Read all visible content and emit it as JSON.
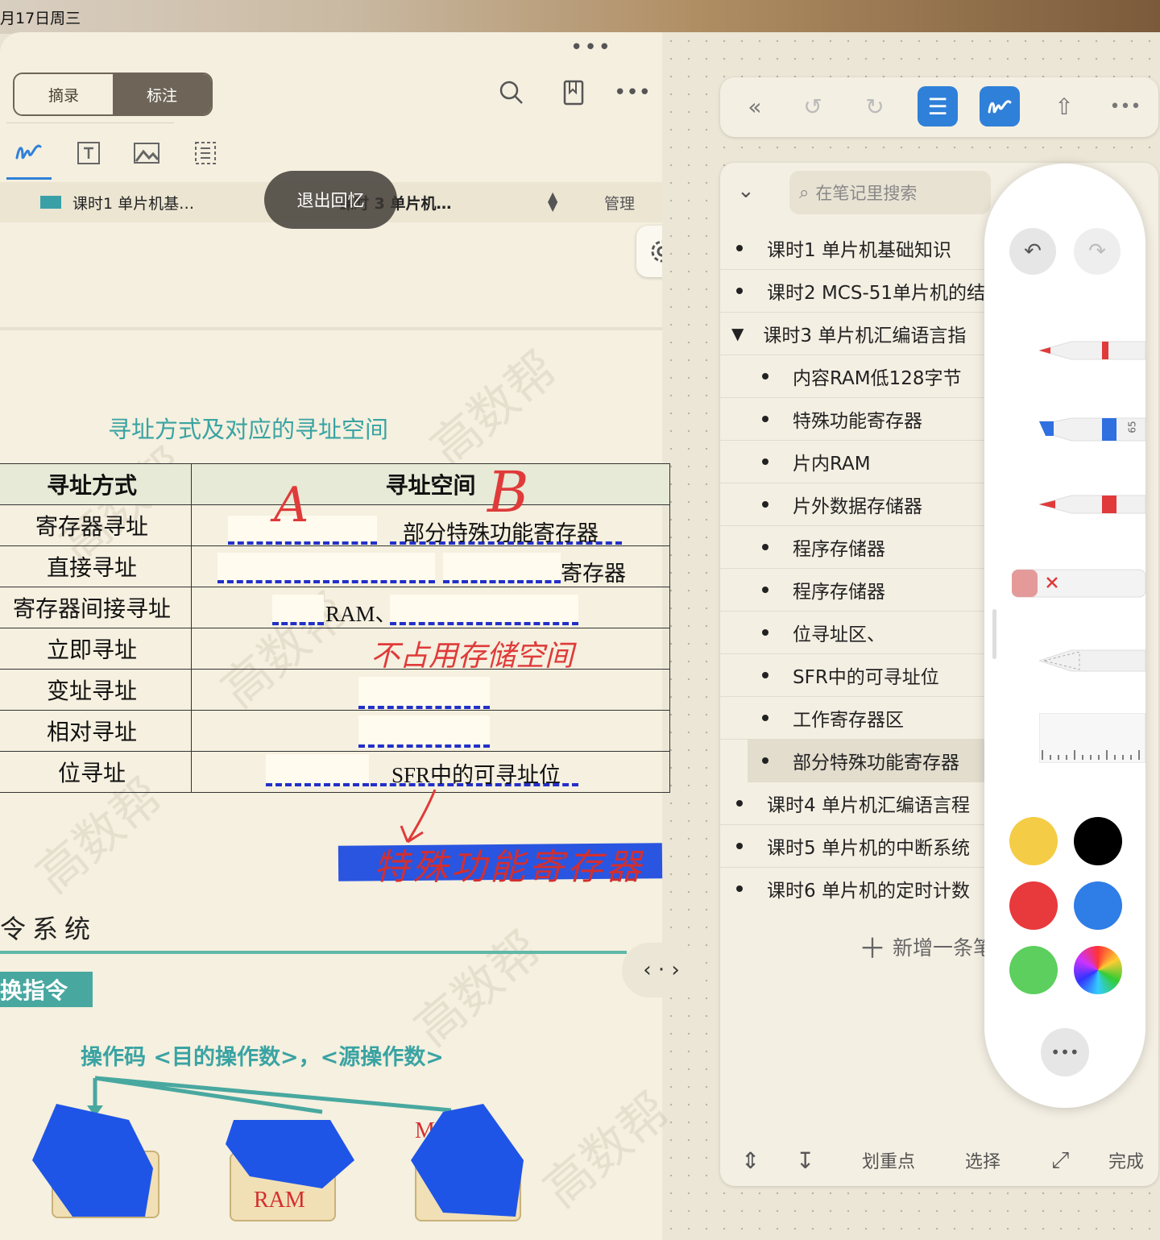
{
  "status_bar": {
    "date": "月17日周三"
  },
  "left_pane": {
    "segment": {
      "excerpt": "摘录",
      "annotate": "标注"
    },
    "doc_tabs": {
      "tab1": "课时1 单片机基…",
      "tab2": "课时 3 单片机…",
      "manage": "管理"
    },
    "recall_exit": "退出回忆",
    "section_title": "寻址方式及对应的寻址空间",
    "table": {
      "headers": [
        "寻址方式",
        "寻址空间"
      ],
      "rows": [
        {
          "mode": "寄存器寻址",
          "space": "部分特殊功能寄存器"
        },
        {
          "mode": "直接寻址",
          "space": "寄存器"
        },
        {
          "mode": "寄存器间接寻址",
          "space": "RAM、"
        },
        {
          "mode": "立即寻址",
          "space": ""
        },
        {
          "mode": "变址寻址",
          "space": ""
        },
        {
          "mode": "相对寻址",
          "space": ""
        },
        {
          "mode": "位寻址",
          "space": "SFR中的可寻址位"
        }
      ]
    },
    "handwriting": {
      "a": "A",
      "b": "B",
      "immediate_note": "不占用存储空间",
      "sfr_note": "特殊功能寄存器"
    },
    "heading_partial": "令系统",
    "subheading_partial": "换指令",
    "operand_line": "操作码 <目的操作数>，<源操作数>",
    "box_labels": {
      "ram": "RAM",
      "mov": "MOV"
    },
    "watermark": "高数帮"
  },
  "right_pane": {
    "search_placeholder": "在笔记里搜索",
    "outline": [
      {
        "label": "课时1 单片机基础知识",
        "level": 0
      },
      {
        "label": "课时2 MCS-51单片机的结",
        "level": 0
      },
      {
        "label": "课时3 单片机汇编语言指",
        "level": 0,
        "expanded": true
      },
      {
        "label": "内容RAM低128字节",
        "level": 1
      },
      {
        "label": "特殊功能寄存器",
        "level": 1
      },
      {
        "label": "片内RAM",
        "level": 1
      },
      {
        "label": "片外数据存储器",
        "level": 1
      },
      {
        "label": "程序存储器",
        "level": 1
      },
      {
        "label": "程序存储器",
        "level": 1
      },
      {
        "label": "位寻址区、",
        "level": 1
      },
      {
        "label": "SFR中的可寻址位",
        "level": 1
      },
      {
        "label": "工作寄存器区",
        "level": 1
      },
      {
        "label": "部分特殊功能寄存器",
        "level": 1,
        "selected": true
      },
      {
        "label": "课时4 单片机汇编语言程",
        "level": 0
      },
      {
        "label": "课时5 单片机的中断系统",
        "level": 0
      },
      {
        "label": "课时6 单片机的定时计数",
        "level": 0
      }
    ],
    "add_item": "新增一条笔",
    "bottom": {
      "highlight": "划重点",
      "select": "选择",
      "done": "完成"
    }
  },
  "palette": {
    "marker_size": "65",
    "colors": [
      "#f5cc45",
      "#000000",
      "#e8393c",
      "#2f7de6",
      "#5ccf5e",
      "rainbow"
    ]
  }
}
